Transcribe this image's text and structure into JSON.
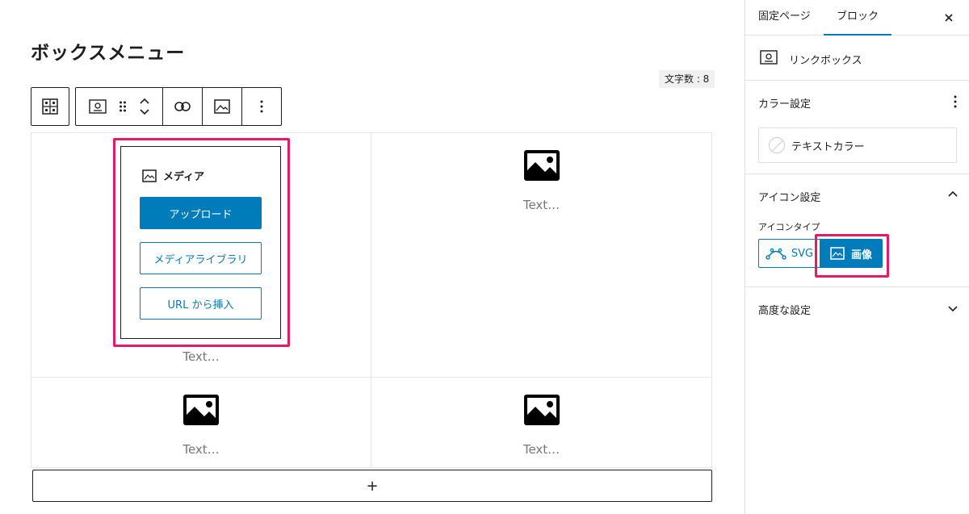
{
  "editor": {
    "page_title": "ボックスメニュー",
    "word_count": "文字数 : 8",
    "appender_label": "+"
  },
  "toolbar": {
    "parent_icon": "grid-parent-icon",
    "block_icon": "link-box-icon",
    "drag_icon": "drag-handle-icon",
    "move_up_icon": "chevron-up-icon",
    "move_down_icon": "chevron-down-icon",
    "link_icon": "link-icon",
    "image_icon": "image-icon",
    "more_icon": "more-vertical-icon"
  },
  "grid": {
    "cells": [
      {
        "text": "Text…",
        "icon": "image-icon"
      },
      {
        "text": "Text…",
        "icon": "image-icon"
      },
      {
        "text": "Text…",
        "icon": "image-icon"
      },
      {
        "text": "Text…",
        "icon": "image-icon"
      }
    ]
  },
  "media_placeholder": {
    "label": "メディア",
    "upload": "アップロード",
    "library": "メディアライブラリ",
    "url_insert": "URL から挿入"
  },
  "sidebar": {
    "tabs": [
      "固定ページ",
      "ブロック"
    ],
    "active_tab": "ブロック",
    "block_name": "リンクボックス",
    "color_settings": {
      "title": "カラー設定",
      "text_color": "テキストカラー"
    },
    "icon_settings": {
      "title": "アイコン設定",
      "icon_type_label": "アイコンタイプ",
      "options": [
        "SVG",
        "画像"
      ],
      "selected": "画像"
    },
    "advanced": {
      "title": "高度な設定"
    }
  },
  "colors": {
    "primary": "#007cba",
    "highlight": "#e71a64",
    "text": "#1e1e1e",
    "muted": "#757575",
    "border": "#e0e0e0"
  }
}
